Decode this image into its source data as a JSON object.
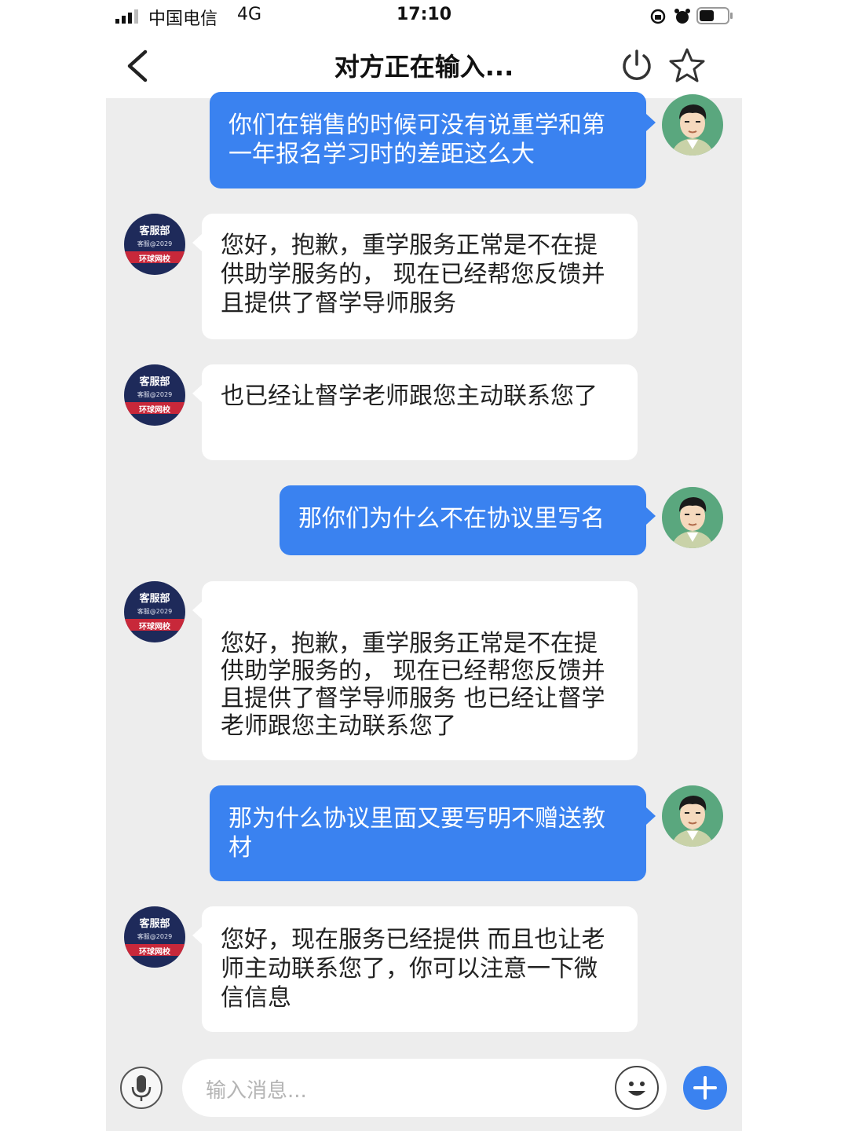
{
  "status_bar": {
    "carrier": "中国电信",
    "network": "4G",
    "time": "17:10"
  },
  "nav": {
    "title": "对方正在输入..."
  },
  "customer_service_avatar": {
    "line1": "客服部",
    "line2": "客服@2029",
    "line3": "环球网校"
  },
  "messages": [
    {
      "side": "sent",
      "text": "你们在销售的时候可没有说重学和第一年报名学习时的差距这么大"
    },
    {
      "side": "received",
      "text": "您好，抱歉，重学服务正常是不在提供助学服务的， 现在已经帮您反馈并且提供了督学导师服务"
    },
    {
      "side": "received",
      "text": "也已经让督学老师跟您主动联系您了"
    },
    {
      "side": "sent",
      "text": "那你们为什么不在协议里写名"
    },
    {
      "side": "received",
      "text": "您好，抱歉，重学服务正常是不在提供助学服务的， 现在已经帮您反馈并且提供了督学导师服务  也已经让督学老师跟您主动联系您了"
    },
    {
      "side": "sent",
      "text": "那为什么协议里面又要写明不赠送教材"
    },
    {
      "side": "received",
      "text": "您好，现在服务已经提供  而且也让老师主动联系您了，你可以注意一下微信信息"
    }
  ],
  "input_bar": {
    "placeholder": "输入消息..."
  },
  "icons": {
    "back": "chevron-left-icon",
    "power": "power-icon",
    "favorite": "star-icon",
    "voice": "microphone-icon",
    "emoji": "smiley-icon",
    "more": "plus-icon"
  },
  "colors": {
    "sent_bubble": "#3a82f0",
    "received_bubble": "#ffffff",
    "chat_background": "#ededed",
    "user_avatar_bg": "#5aa77e",
    "cs_avatar_bg": "#1e2a5a",
    "cs_avatar_band": "#c8283a"
  }
}
